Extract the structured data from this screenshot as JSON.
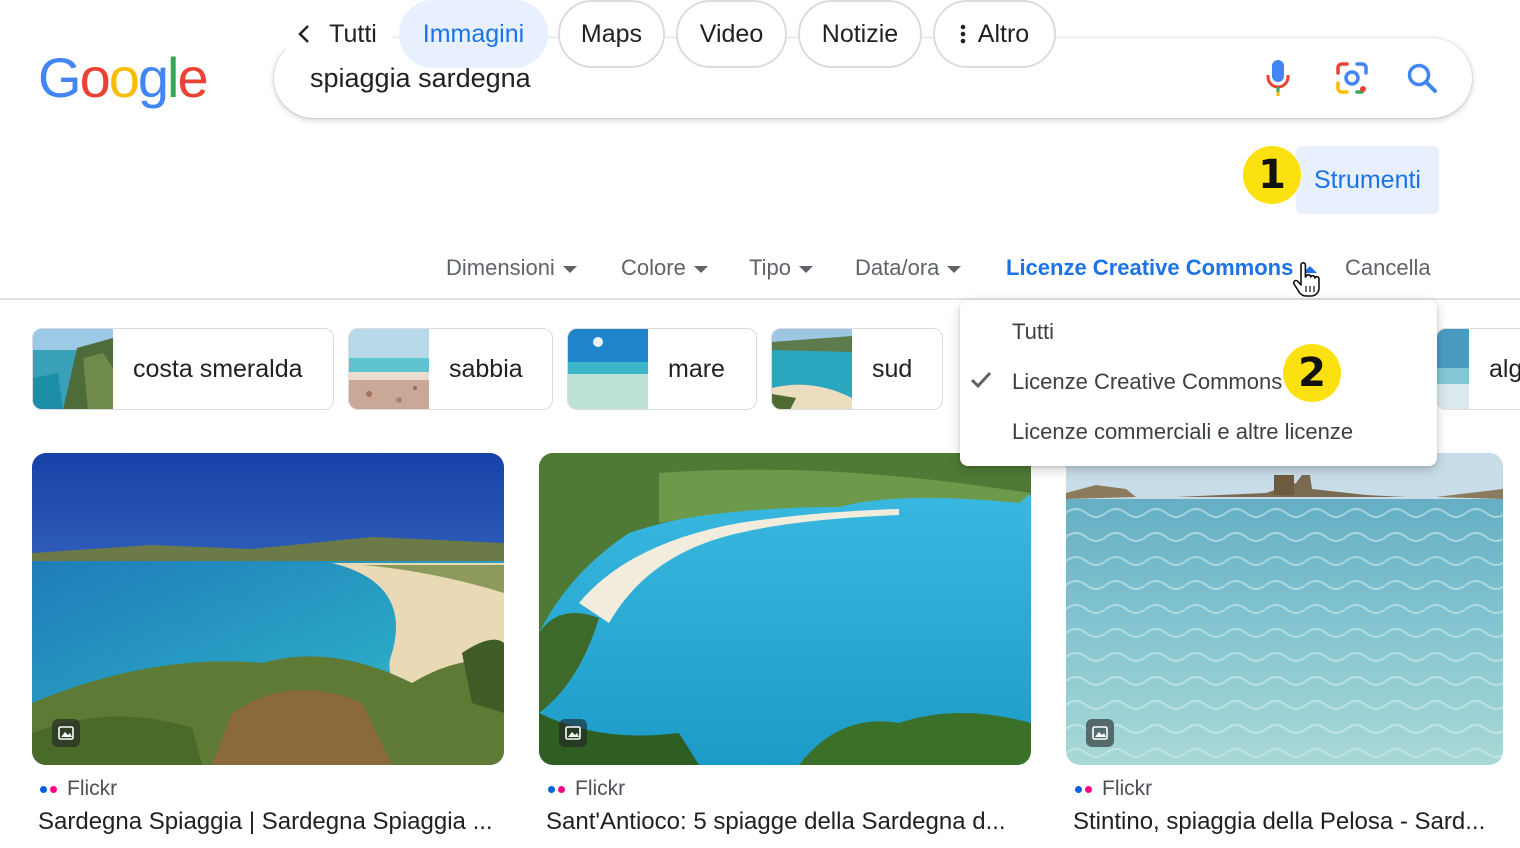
{
  "logo": {
    "letters": [
      "G",
      "o",
      "o",
      "g",
      "l",
      "e"
    ],
    "colors": [
      "#4285f4",
      "#ea4335",
      "#fbbc05",
      "#4285f4",
      "#34a853",
      "#ea4335"
    ]
  },
  "search": {
    "query": "spiaggia sardegna",
    "mic_icon": "mic-icon",
    "lens_icon": "lens-icon",
    "search_icon": "search-icon"
  },
  "tabs": {
    "back_label": "Tutti",
    "items": [
      "Immagini",
      "Maps",
      "Video",
      "Notizie",
      "Altro"
    ],
    "active": "Immagini",
    "tools_label": "Strumenti"
  },
  "annotations": {
    "badge1": "1",
    "badge2": "2",
    "badge_color": "#fbe10f"
  },
  "filters": {
    "items": [
      "Dimensioni",
      "Colore",
      "Tipo",
      "Data/ora",
      "Licenze Creative Commons"
    ],
    "clear_label": "Cancella",
    "active": "Licenze Creative Commons"
  },
  "chips": [
    {
      "label": "costa smeralda"
    },
    {
      "label": "sabbia"
    },
    {
      "label": "mare"
    },
    {
      "label": "sud"
    },
    {
      "label": "alg"
    }
  ],
  "dropdown": {
    "items": [
      "Tutti",
      "Licenze Creative Commons",
      "Licenze commerciali e altre licenze"
    ],
    "selected": "Licenze Creative Commons"
  },
  "results": [
    {
      "source": "Flickr",
      "title": "Sardegna Spiaggia | Sardegna Spiaggia ..."
    },
    {
      "source": "Flickr",
      "title": "Sant'Antioco: 5 spiagge della Sardegna d..."
    },
    {
      "source": "Flickr",
      "title": "Stintino, spiaggia della Pelosa - Sard..."
    }
  ],
  "colors": {
    "accent": "#1a73e8",
    "active_bg": "#e8f0fe",
    "flickr_blue": "#0063dc",
    "flickr_pink": "#ff0084"
  }
}
